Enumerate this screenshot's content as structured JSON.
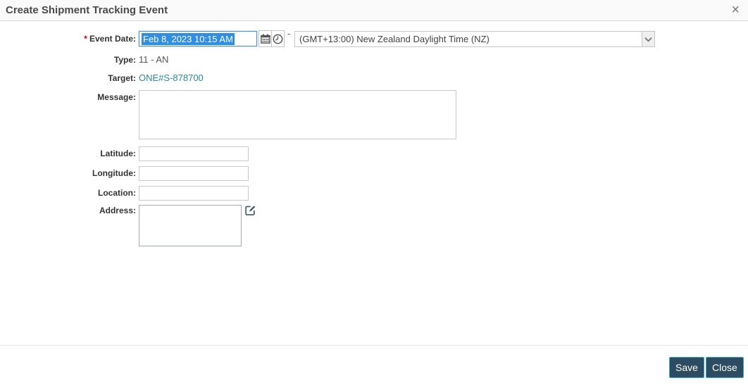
{
  "window": {
    "title": "Create Shipment Tracking Event",
    "close_glyph": "×"
  },
  "form": {
    "event_date": {
      "required_marker": "*",
      "label": "Event Date:",
      "value": "Feb 8, 2023 10:15 AM",
      "separator": "-",
      "timezone_selected": "(GMT+13:00) New Zealand Daylight Time (NZ)"
    },
    "type": {
      "label": "Type:",
      "value": "11 - AN"
    },
    "target": {
      "label": "Target:",
      "value": "ONE#S-878700"
    },
    "message": {
      "label": "Message:",
      "value": ""
    },
    "latitude": {
      "label": "Latitude:",
      "value": ""
    },
    "longitude": {
      "label": "Longitude:",
      "value": ""
    },
    "location": {
      "label": "Location:",
      "value": ""
    },
    "address": {
      "label": "Address:",
      "value": ""
    }
  },
  "footer": {
    "save_label": "Save",
    "close_label": "Close"
  },
  "icons": {
    "calendar": "calendar-icon",
    "clock": "clock-icon",
    "edit": "edit-icon",
    "chevron_down": "chevron-down-icon",
    "close": "close-icon"
  },
  "colors": {
    "button_bg": "#2d4b61",
    "button_border": "#3aa8c1",
    "selection_bg": "#2f8ee4",
    "focus_border": "#4a90d9",
    "link": "#2e86a5",
    "required": "#cc0000"
  }
}
